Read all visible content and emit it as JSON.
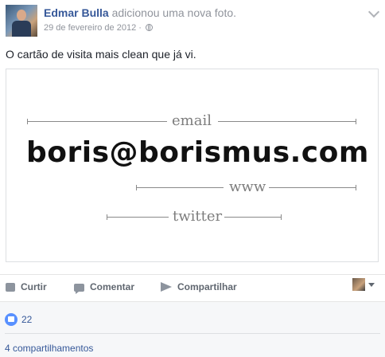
{
  "post": {
    "author": "Edmar Bulla",
    "action": "adicionou uma nova foto.",
    "date": "29 de fevereiro de 2012",
    "separator": "·",
    "text": "O cartão de visita mais clean que já vi."
  },
  "card": {
    "label_email": "email",
    "email": "boris@borismus.com",
    "label_www": "www",
    "label_twitter": "twitter"
  },
  "actions": {
    "like": "Curtir",
    "comment": "Comentar",
    "share": "Compartilhar"
  },
  "footer": {
    "reaction_count": "22",
    "shares": "4 compartilhamentos"
  },
  "icons": [
    "globe-icon",
    "chevron-down-icon",
    "like-icon",
    "comment-icon",
    "share-icon",
    "caret-icon",
    "reaction-like-icon"
  ],
  "colors": {
    "link": "#365899",
    "muted": "#90949c",
    "like_blue": "#5890ff"
  }
}
